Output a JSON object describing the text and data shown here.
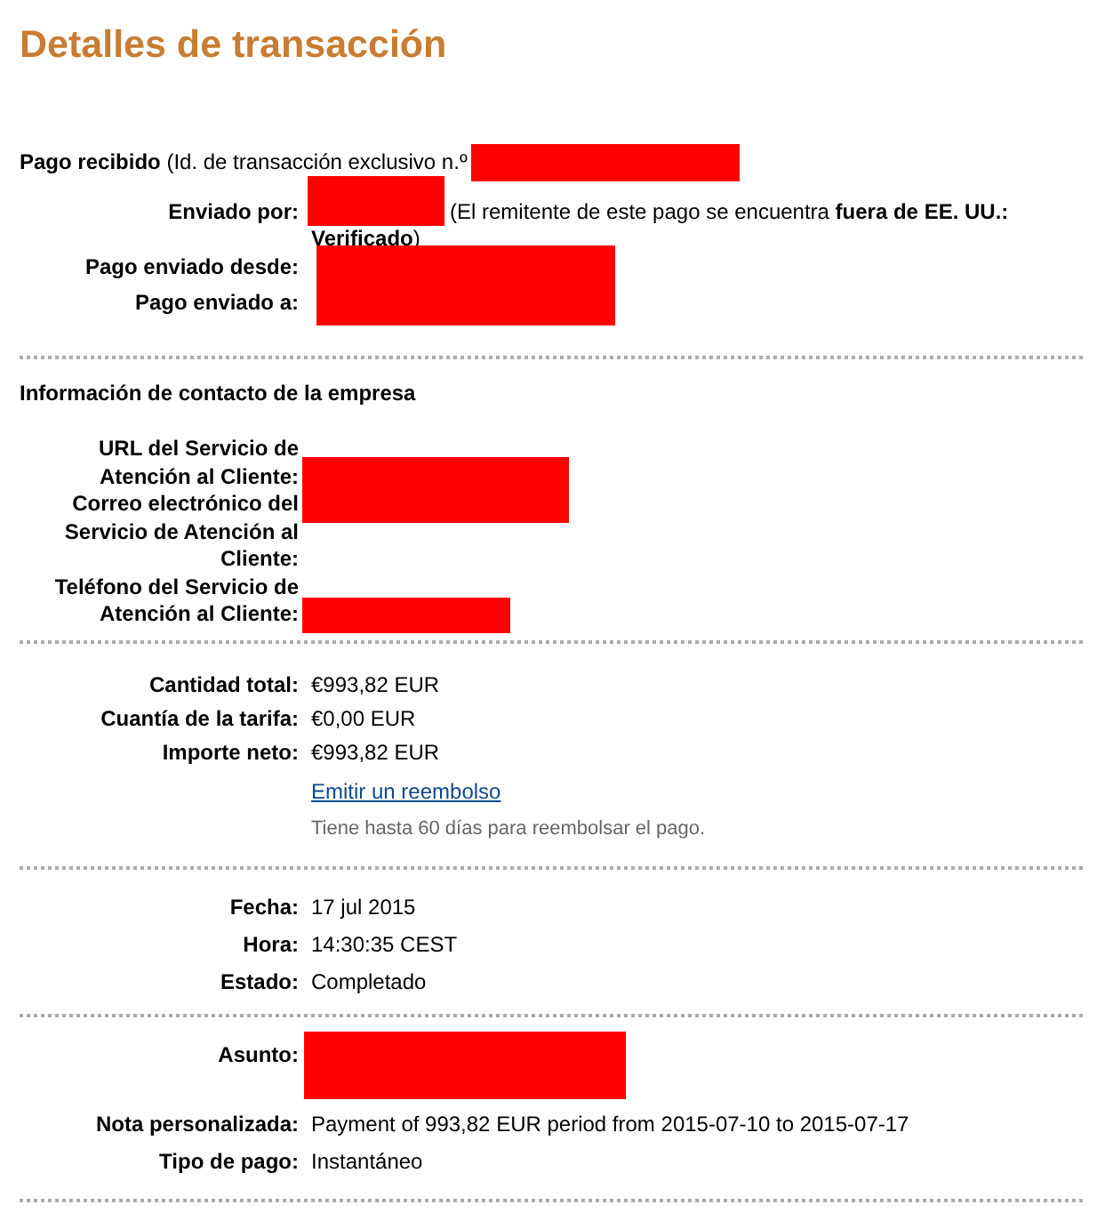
{
  "title": "Detalles de transacción",
  "sections": [
    {
      "kind": "summary",
      "intro": {
        "text": "**Pago recibido** (Id. de transacción exclusivo n.º",
        "redacted": true
      },
      "fields": [
        {
          "labels": [
            "Enviado por:"
          ],
          "redacted": true,
          "value": "(El remitente de este pago se encuentra **fuera de EE. UU.: Verificado**)"
        },
        {
          "labels": [
            "Pago enviado desde:",
            "Pago enviado a:"
          ],
          "redacted": true
        }
      ]
    },
    {
      "kind": "contact",
      "heading": "Información de contacto de la empresa",
      "fields": [
        {
          "labels": [
            "URL del Servicio de Atención al Cliente:",
            "Correo electrónico del Servicio de Atención al Cliente:"
          ],
          "redacted": true
        },
        {
          "labels": [
            "Teléfono del Servicio de Atención al Cliente:"
          ],
          "redacted": true
        }
      ]
    },
    {
      "kind": "amounts",
      "fields": [
        {
          "labels": [
            "Cantidad total:"
          ],
          "redacted": false,
          "value": "€993,82 EUR"
        },
        {
          "labels": [
            "Cuantía de la tarifa:"
          ],
          "redacted": false,
          "value": "€0,00 EUR"
        },
        {
          "labels": [
            "Importe neto:"
          ],
          "redacted": false,
          "value": "€993,82 EUR"
        }
      ],
      "refund_link": "Emitir un reembolso",
      "refund_note": "Tiene hasta 60 días para reembolsar el pago."
    },
    {
      "kind": "details",
      "fields": [
        {
          "labels": [
            "Fecha:"
          ],
          "redacted": false,
          "value": "17 jul 2015"
        },
        {
          "labels": [
            "Hora:"
          ],
          "redacted": false,
          "value": "14:30:35 CEST"
        },
        {
          "labels": [
            "Estado:"
          ],
          "redacted": false,
          "value": "Completado"
        }
      ]
    },
    {
      "kind": "details",
      "fields": [
        {
          "labels": [
            "Asunto:"
          ],
          "redacted": true
        },
        {
          "labels": [
            "Nota personalizada:"
          ],
          "redacted": false,
          "value": "Payment of 993,82 EUR period from 2015-07-10 to 2015-07-17"
        },
        {
          "labels": [
            "Tipo de pago:"
          ],
          "redacted": false,
          "value": "Instantáneo"
        }
      ]
    }
  ]
}
